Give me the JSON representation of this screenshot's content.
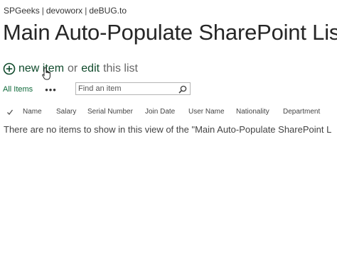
{
  "breadcrumb": {
    "items": [
      "SPGeeks",
      "devoworx",
      "deBUG.to"
    ],
    "separator": "|"
  },
  "page": {
    "title": "Main Auto-Populate SharePoint List"
  },
  "actions": {
    "new_item": "new item",
    "or": "or",
    "edit": "edit",
    "tail": "this list"
  },
  "view": {
    "name": "All Items",
    "more": "•••"
  },
  "search": {
    "placeholder": "Find an item",
    "value": ""
  },
  "columns": {
    "headers": [
      "Name",
      "Salary",
      "Serial Number",
      "Join Date",
      "User Name",
      "Nationality",
      "Department"
    ]
  },
  "list": {
    "empty_message": "There are no items to show in this view of the \"Main Auto-Populate SharePoint L"
  },
  "colors": {
    "accent": "#0f4a2b",
    "text": "#444444",
    "title": "#262626"
  },
  "icons": {
    "add": "plus-circle-icon",
    "cursor": "hand-pointer-icon",
    "search": "search-icon",
    "check": "checkmark-icon"
  }
}
